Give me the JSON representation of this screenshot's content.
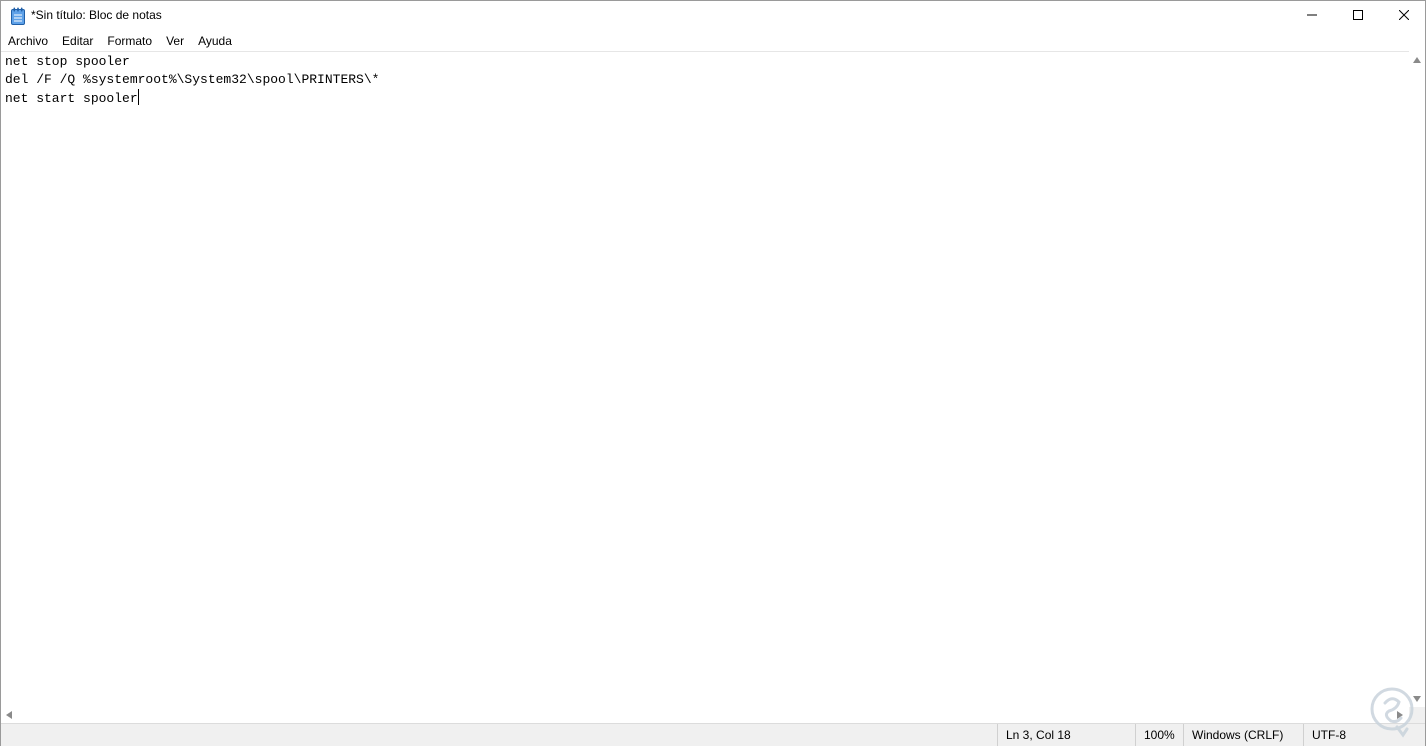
{
  "window": {
    "title": "*Sin título: Bloc de notas",
    "icon": "notepad-icon"
  },
  "caption_buttons": {
    "minimize_icon": "minimize-icon",
    "maximize_icon": "maximize-icon",
    "close_icon": "close-icon"
  },
  "menu": {
    "items": [
      {
        "label": "Archivo"
      },
      {
        "label": "Editar"
      },
      {
        "label": "Formato"
      },
      {
        "label": "Ver"
      },
      {
        "label": "Ayuda"
      }
    ]
  },
  "editor": {
    "lines": [
      "net stop spooler",
      "del /F /Q %systemroot%\\System32\\spool\\PRINTERS\\*",
      "net start spooler"
    ]
  },
  "status": {
    "position": "Ln 3, Col 18",
    "zoom": "100%",
    "line_ending": "Windows (CRLF)",
    "encoding": "UTF-8"
  },
  "colors": {
    "accent_icon": "#2b7bd6",
    "status_bg": "#f0f0f0"
  }
}
